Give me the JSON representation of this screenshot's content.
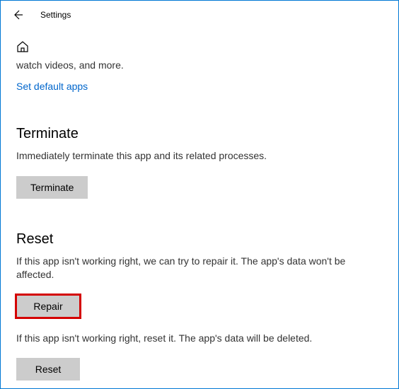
{
  "header": {
    "title": "Settings"
  },
  "truncated": "watch videos, and more.",
  "link": "Set default apps",
  "terminate": {
    "title": "Terminate",
    "desc": "Immediately terminate this app and its related processes.",
    "button": "Terminate"
  },
  "reset": {
    "title": "Reset",
    "desc1": "If this app isn't working right, we can try to repair it. The app's data won't be affected.",
    "repair_button": "Repair",
    "desc2": "If this app isn't working right, reset it. The app's data will be deleted.",
    "reset_button": "Reset"
  }
}
